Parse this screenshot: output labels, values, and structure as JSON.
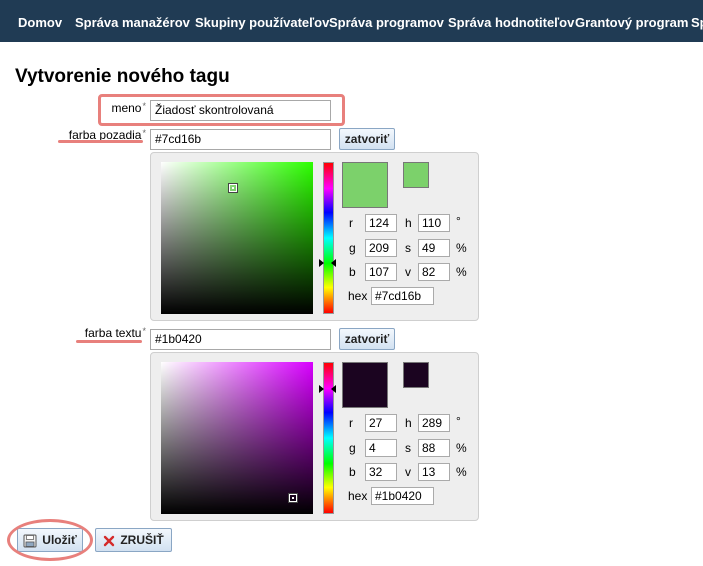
{
  "nav": {
    "items": [
      "Domov",
      "Správa manažérov",
      "Skupiny používateľov",
      "Správa programov",
      "Správa hodnotiteľov",
      "Grantový program",
      "Sp"
    ]
  },
  "page": {
    "title": "Vytvorenie nového tagu"
  },
  "form": {
    "name": {
      "label": "meno",
      "value": "Žiadosť skontrolovaná"
    },
    "bg": {
      "label": "farba pozadia",
      "value": "#7cd16b",
      "close": "zatvoriť",
      "picker": {
        "color": "#7cd16b",
        "hue_color": "#2cff00",
        "r_label": "r",
        "r": "124",
        "g_label": "g",
        "g": "209",
        "b_label": "b",
        "b": "107",
        "h_label": "h",
        "h": "110",
        "h_unit": "°",
        "s_label": "s",
        "s": "49",
        "s_unit": "%",
        "v_label": "v",
        "v": "82",
        "v_unit": "%",
        "hex_label": "hex",
        "hex": "#7cd16b"
      }
    },
    "text": {
      "label": "farba textu",
      "value": "#1b0420",
      "close": "zatvoriť",
      "picker": {
        "color": "#1b0420",
        "hue_color": "#d800ff",
        "r_label": "r",
        "r": "27",
        "g_label": "g",
        "g": "4",
        "b_label": "b",
        "b": "32",
        "h_label": "h",
        "h": "289",
        "h_unit": "°",
        "s_label": "s",
        "s": "88",
        "s_unit": "%",
        "v_label": "v",
        "v": "13",
        "v_unit": "%",
        "hex_label": "hex",
        "hex": "#1b0420"
      }
    },
    "required_mark": "*"
  },
  "actions": {
    "save": "Uložiť",
    "cancel": "ZRUŠIŤ"
  },
  "colors": {
    "nav_bg": "#203b54",
    "annotation": "#e8807c"
  }
}
